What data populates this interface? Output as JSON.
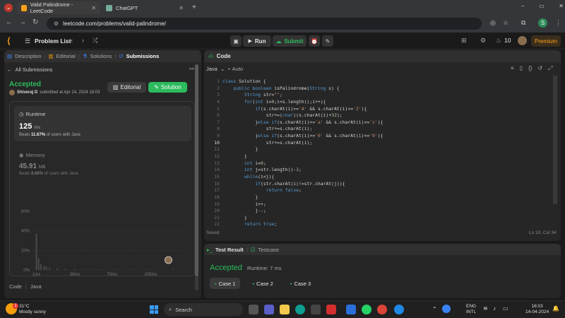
{
  "browser": {
    "tabs": [
      {
        "title": "Valid Palindrome - LeetCode",
        "active": true
      },
      {
        "title": "ChatGPT",
        "active": false
      }
    ],
    "new_tab": "+",
    "url": "leetcode.com/problems/valid-palindrome/",
    "profile_letter": "S",
    "window_controls": [
      "–",
      "▭",
      "✕"
    ]
  },
  "leetcode": {
    "problem_list": "Problem List",
    "run": "Run",
    "submit": "Submit",
    "streak": "10",
    "premium": "Premium"
  },
  "left_panel": {
    "tabs": [
      "Description",
      "Editorial",
      "Solutions",
      "Submissions"
    ],
    "back": "All Submissions",
    "status": "Accepted",
    "user": "Shiveraj D",
    "submitted": "submitted at Apr 14, 2024 18:03",
    "editorial_btn": "Editorial",
    "solution_btn": "Solution",
    "runtime_label": "Runtime",
    "runtime_value": "125",
    "runtime_unit": "ms",
    "runtime_beats_pre": "Beats",
    "runtime_beats_pct": "11.67%",
    "runtime_beats_post": "of users with Java",
    "memory_label": "Memory",
    "memory_value": "45.91",
    "memory_unit": "MB",
    "memory_beats_pre": "Beats",
    "memory_beats_pct": "8.68%",
    "memory_beats_post": "of users with Java",
    "code_label": "Code",
    "lang_label": "Java"
  },
  "chart_data": {
    "type": "bar",
    "y_ticks": [
      "60%",
      "40%",
      "20%",
      "0%"
    ],
    "x_ticks": [
      "1ms",
      "36ms",
      "70ms",
      "105ms"
    ],
    "mini_x_ticks": [
      "1ms",
      "36ms",
      "70ms",
      "105ms"
    ],
    "ylim": [
      0,
      60
    ],
    "bars": [
      {
        "x": 1,
        "value": 37
      },
      {
        "x": 3,
        "value": 12
      },
      {
        "x": 5,
        "value": 6
      },
      {
        "x": 8,
        "value": 4
      },
      {
        "x": 10,
        "value": 3
      },
      {
        "x": 13,
        "value": 2
      },
      {
        "x": 20,
        "value": 1.5
      },
      {
        "x": 27,
        "value": 1
      },
      {
        "x": 36,
        "value": 0.8
      },
      {
        "x": 48,
        "value": 0.6
      },
      {
        "x": 60,
        "value": 0.5
      },
      {
        "x": 75,
        "value": 0.4
      },
      {
        "x": 90,
        "value": 0.4
      },
      {
        "x": 105,
        "value": 0.3
      },
      {
        "x": 125,
        "value": 0.3
      }
    ],
    "xlim": [
      0,
      135
    ]
  },
  "editor": {
    "title": "Code",
    "language": "Java",
    "auto": "Auto",
    "saved": "Saved",
    "cursor": "Ln 10, Col 34",
    "current_line": 10,
    "lines": [
      "class Solution {",
      "    public boolean isPalindrome(String s) {",
      "        String str=\"\";",
      "        for(int i=0;i<s.length();i++){",
      "            if(s.charAt(i)>='A' && s.charAt(i)<='Z'){",
      "                str+=(char)(s.charAt(i)+32);",
      "            }else if(s.charAt(i)>='a' && s.charAt(i)<='z'){",
      "                str+=s.charAt(i);",
      "            }else if(s.charAt(i)>='0' && s.charAt(i)<='9'){",
      "                str+=s.charAt(i);",
      "            }",
      "        }",
      "        int i=0;",
      "        int j=str.length()-1;",
      "        while(i<j){",
      "            if(str.charAt(i)!=str.charAt(j)){",
      "                return false;",
      "            }",
      "            i++;",
      "            j--;",
      "        }",
      "        return true;"
    ]
  },
  "test": {
    "tab_result": "Test Result",
    "tab_testcase": "Testcase",
    "status": "Accepted",
    "runtime": "Runtime: 7 ms",
    "cases": [
      "Case 1",
      "Case 2",
      "Case 3"
    ]
  },
  "taskbar": {
    "weather_temp": "31°C",
    "weather_desc": "Mostly sunny",
    "search": "Search",
    "lang1": "ENG",
    "lang2": "INTL",
    "time": "18:03",
    "date": "14-04-2024",
    "badge": "1"
  }
}
